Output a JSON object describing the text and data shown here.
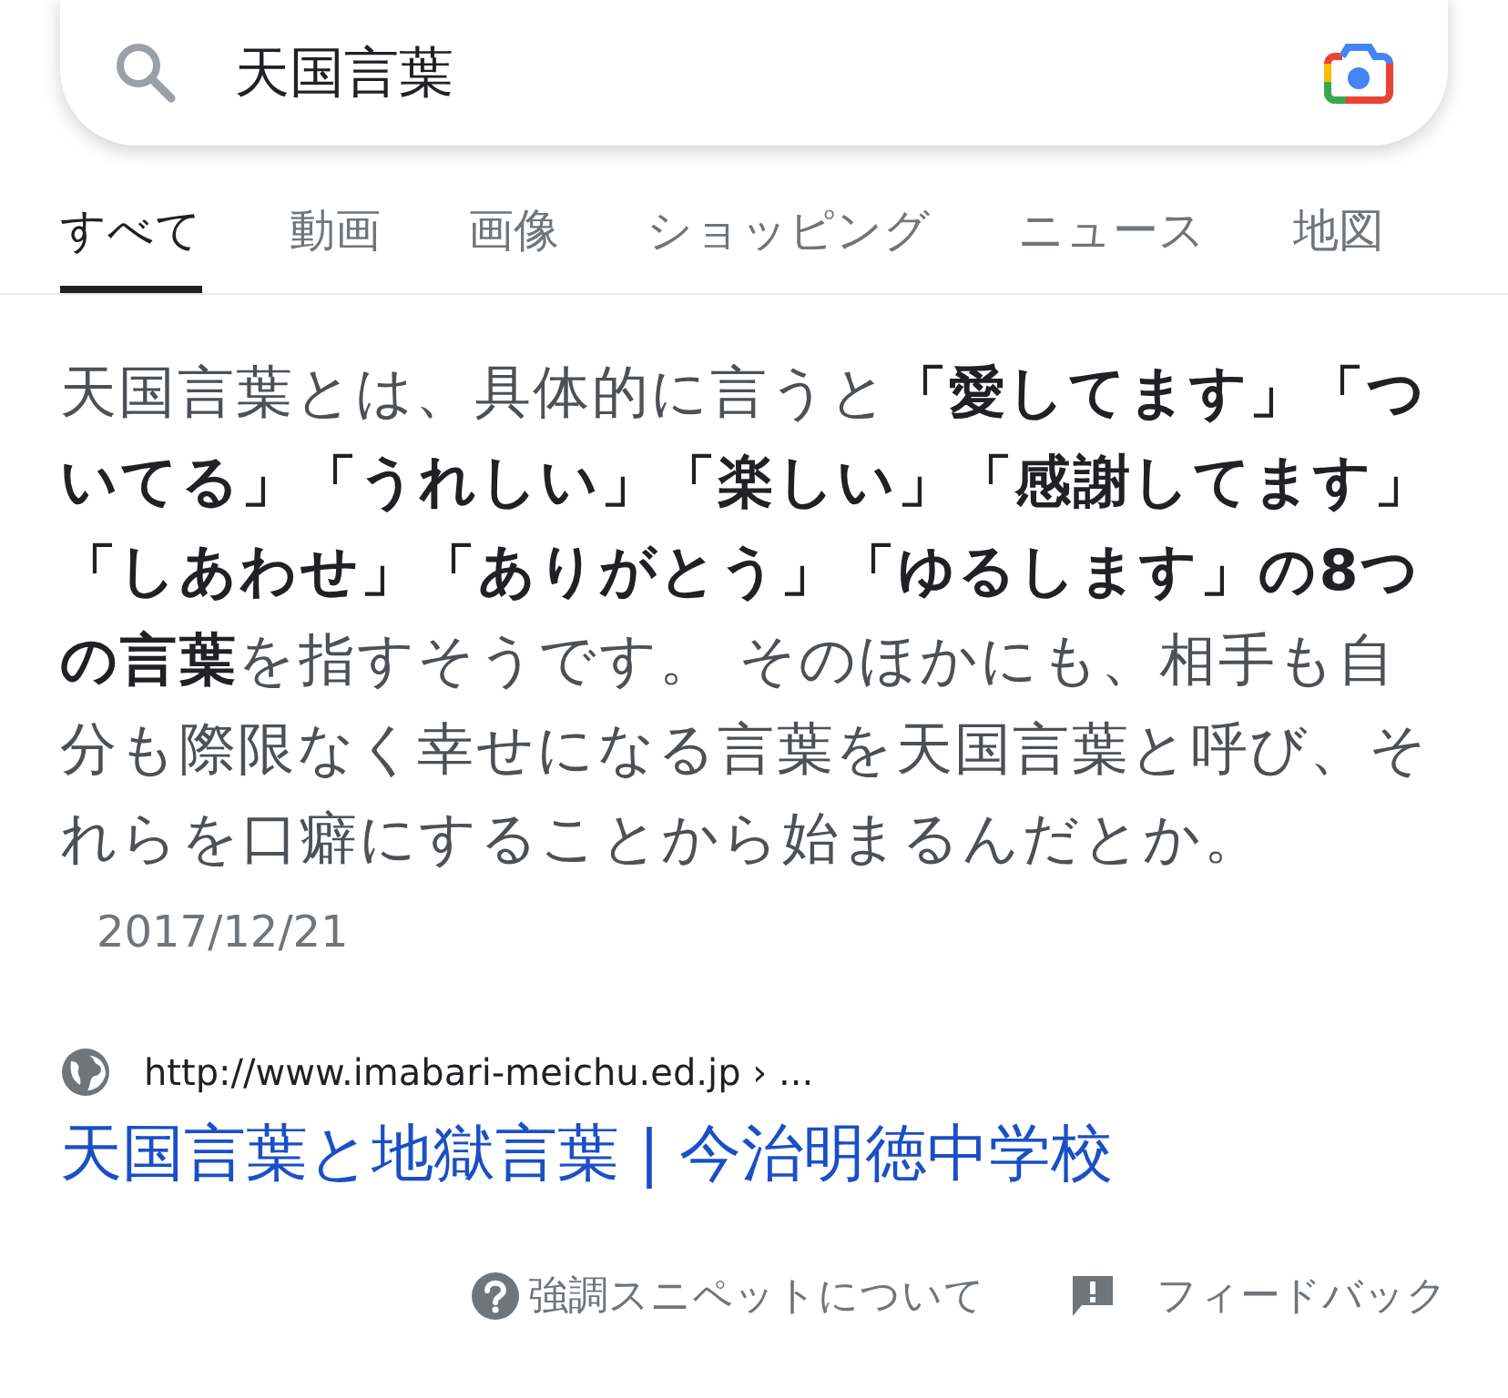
{
  "search": {
    "query": "天国言葉"
  },
  "tabs": [
    {
      "label": "すべて",
      "selected": true
    },
    {
      "label": "動画",
      "selected": false
    },
    {
      "label": "画像",
      "selected": false
    },
    {
      "label": "ショッピング",
      "selected": false
    },
    {
      "label": "ニュース",
      "selected": false
    },
    {
      "label": "地図",
      "selected": false
    }
  ],
  "snippet": {
    "text": "天国言葉とは、具体的に言うと**「愛してます」「ついてる」「うれしい」「楽しい」「感謝してます」「しあわせ」「ありがとう」「ゆるします」の8つの言葉**を指すそうです。 そのほかにも、相手も自分も際限なく幸せになる言葉を天国言葉と呼び、それらを口癖にすることから始まるんだとか。",
    "date": "2017/12/21"
  },
  "result": {
    "url": "http://www.imabari-meichu.ed.jp › ...",
    "title": "天国言葉と地獄言葉 | 今治明徳中学校"
  },
  "footer": {
    "about": "強調スニペットについて",
    "feedback": "フィードバック"
  }
}
